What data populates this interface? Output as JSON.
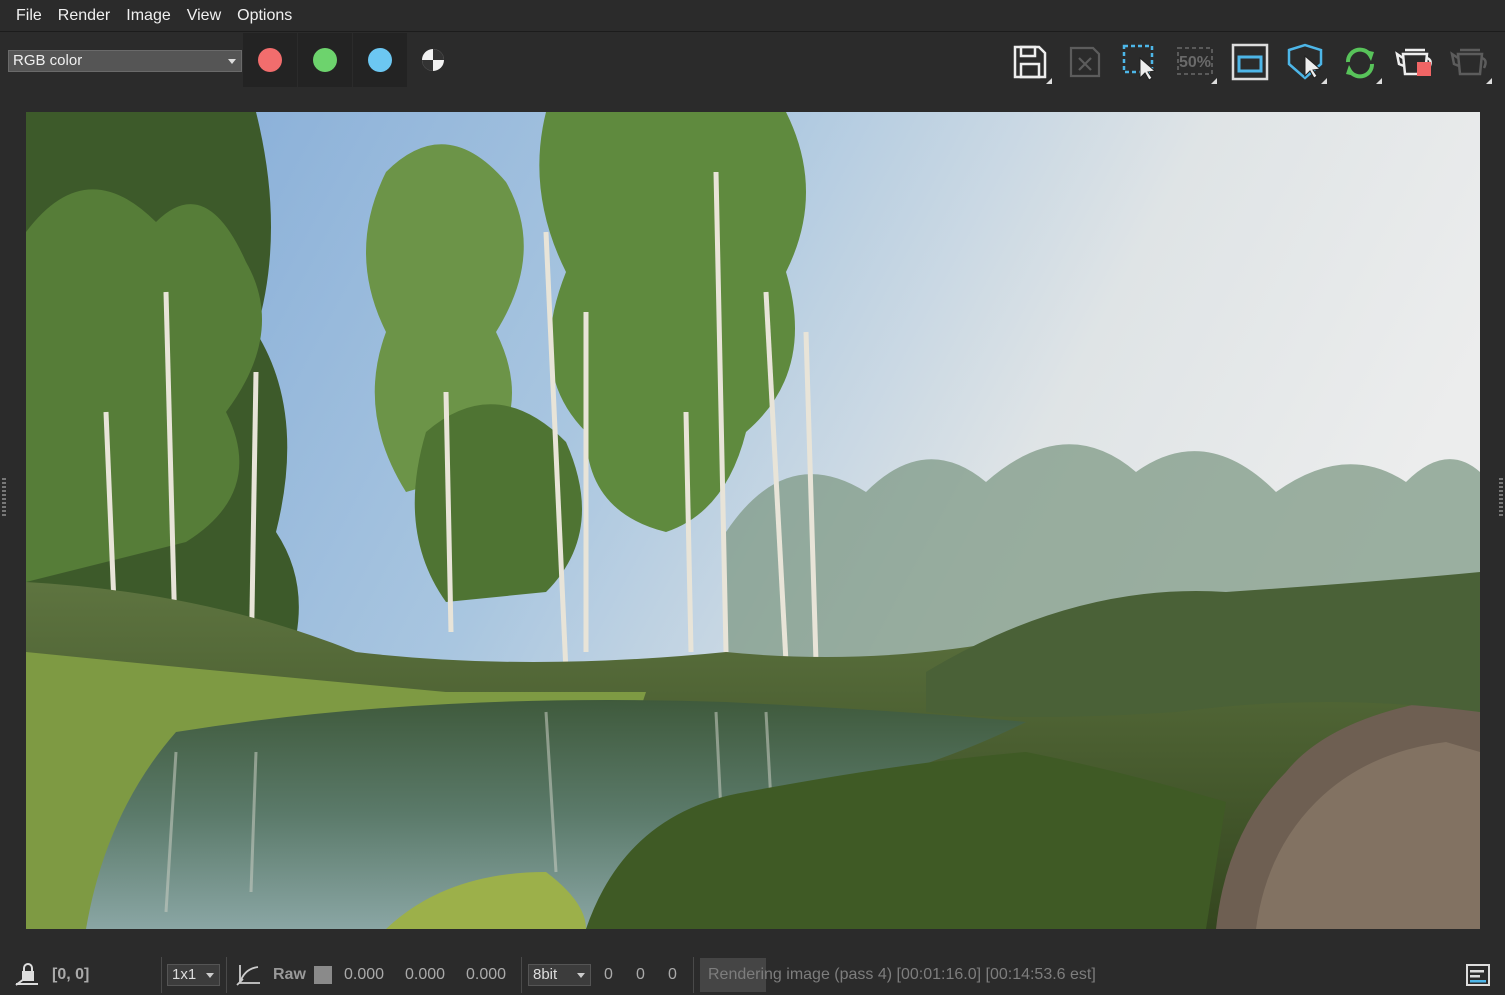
{
  "menu": [
    "File",
    "Render",
    "Image",
    "View",
    "Options"
  ],
  "toolbar": {
    "channel_select": "RGB color",
    "channel_buttons": [
      {
        "name": "red-channel",
        "color": "#f26d6d"
      },
      {
        "name": "green-channel",
        "color": "#6dd36d"
      },
      {
        "name": "blue-channel",
        "color": "#6cc7f2"
      }
    ],
    "zoom_label": "50%",
    "icons": [
      "save-icon",
      "clear-image-icon",
      "region-render-icon",
      "zoom-50-icon",
      "render-frame-icon",
      "track-mouse-icon",
      "render-refresh-icon",
      "render-teapot-icon",
      "render-teapot-disabled-icon"
    ]
  },
  "status": {
    "coords": "[0, 0]",
    "sample": "1x1",
    "raw_label": "Raw",
    "raw_values": [
      "0.000",
      "0.000",
      "0.000"
    ],
    "bit_depth": "8bit",
    "int_values": [
      "0",
      "0",
      "0"
    ],
    "progress_fraction": 0.09,
    "message": "Rendering image (pass 4) [00:01:16.0] [00:14:53.6 est]"
  },
  "colors": {
    "background": "#2b2b2b",
    "accent_blue": "#4db6e8",
    "accent_green": "#58c35a",
    "accent_red": "#f06565"
  }
}
